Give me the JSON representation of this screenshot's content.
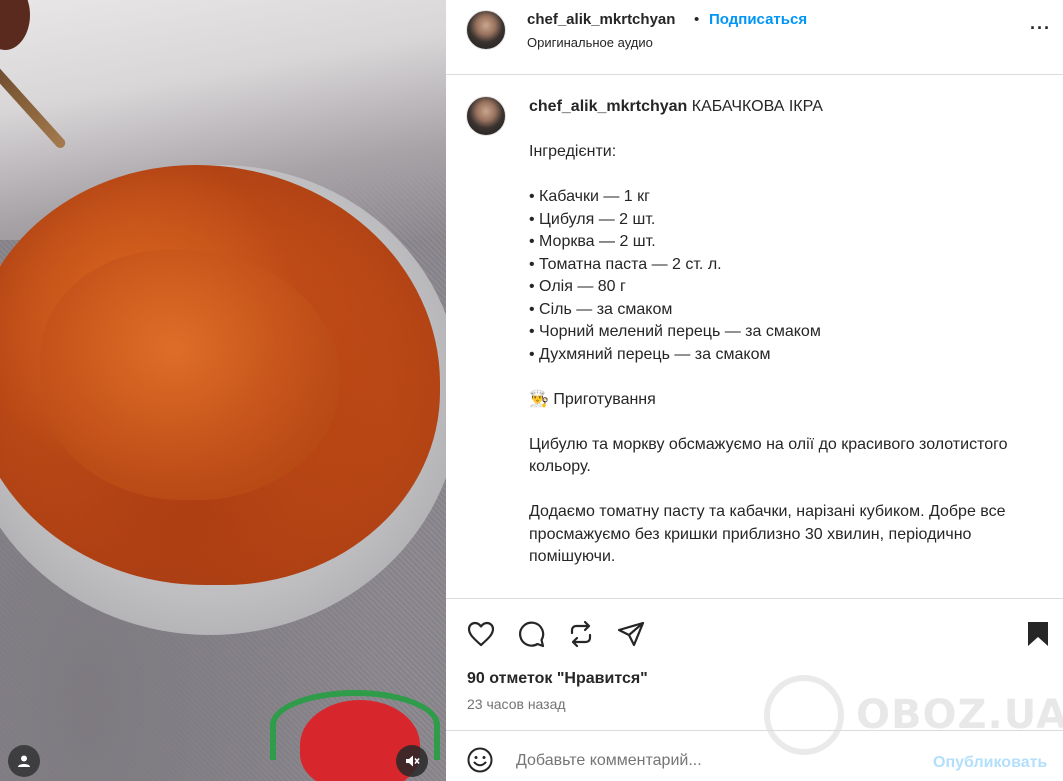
{
  "header": {
    "username": "chef_alik_mkrtchyan",
    "separator": "•",
    "follow_label": "Подписаться",
    "audio_label": "Оригинальное аудио",
    "more_label": "···"
  },
  "caption": {
    "username": "chef_alik_mkrtchyan",
    "title": "КАБАЧКОВА ІКРА",
    "ingredients_heading": "Інгредієнти:",
    "ingredients": [
      "• Кабачки — 1 кг",
      "• Цибуля — 2 шт.",
      "• Морква — 2 шт.",
      "• Томатна паста — 2 ст. л.",
      "• Олія — 80 г",
      "• Сіль — за смаком",
      "• Чорний мелений перець — за смаком",
      "• Духмяний перець — за смаком"
    ],
    "cooking_emoji": "👨‍🍳",
    "cooking_heading": "Приготування",
    "step1": "Цибулю та моркву обсмажуємо на олії до красивого золотистого кольору.",
    "step2": "Додаємо томатну пасту та кабачки, нарізані кубиком. Добре все просмажуємо без кришки приблизно 30 хвилин, періодично помішуючи."
  },
  "actions": {
    "likes_text": "90 отметок \"Нравится\"",
    "time_text": "23 часов назад"
  },
  "comment": {
    "placeholder": "Добавьте комментарий...",
    "publish_label": "Опубликовать"
  },
  "watermark": {
    "text": "OBOZ.UA"
  },
  "colors": {
    "link_blue": "#0095f6",
    "publish_disabled": "#b2dffc",
    "border": "#dbdbdb",
    "secondary_text": "#737373"
  }
}
